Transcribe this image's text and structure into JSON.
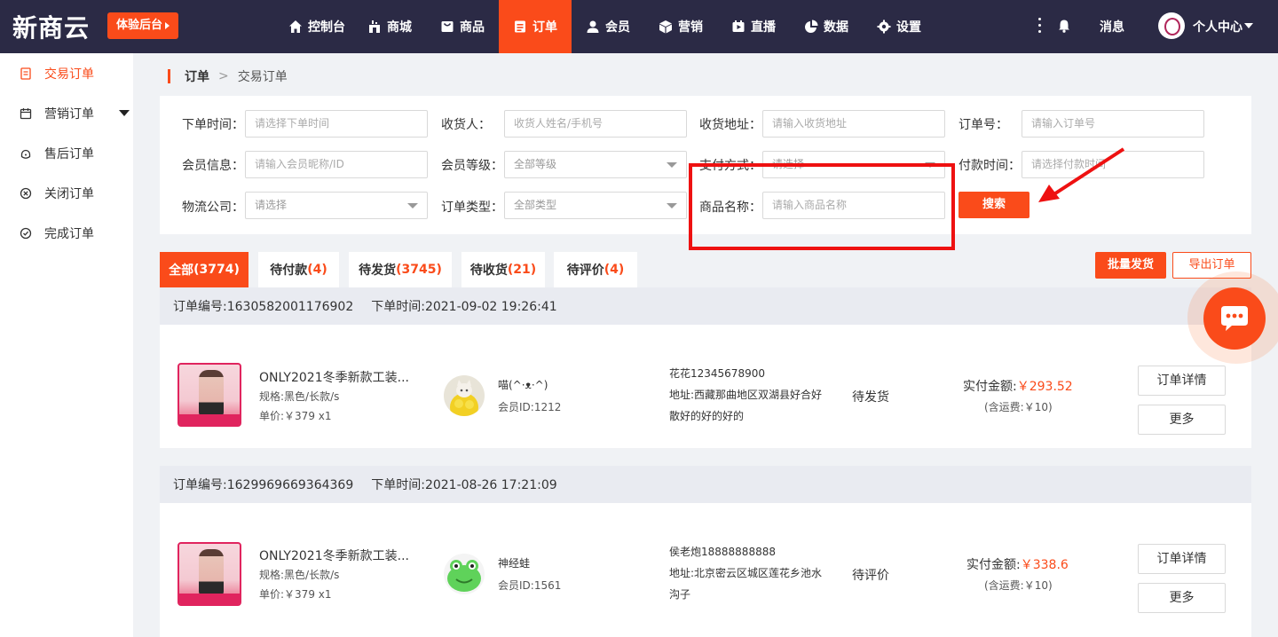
{
  "topbar": {
    "logo": "新商云",
    "trial_button": "体验后台",
    "nav": [
      {
        "label": "控制台",
        "icon": "home-icon",
        "active": false
      },
      {
        "label": "商城",
        "icon": "store-icon",
        "active": false
      },
      {
        "label": "商品",
        "icon": "goods-icon",
        "active": false
      },
      {
        "label": "订单",
        "icon": "order-icon",
        "active": true
      },
      {
        "label": "会员",
        "icon": "user-icon",
        "active": false
      },
      {
        "label": "营销",
        "icon": "cube-icon",
        "active": false
      },
      {
        "label": "直播",
        "icon": "live-icon",
        "active": false
      },
      {
        "label": "数据",
        "icon": "pie-chart-icon",
        "active": false
      },
      {
        "label": "设置",
        "icon": "gear-icon",
        "active": false
      }
    ],
    "messages_label": "消息",
    "profile_label": "个人中心"
  },
  "sidebar": {
    "items": [
      {
        "label": "交易订单",
        "icon": "document-icon",
        "active": true
      },
      {
        "label": "营销订单",
        "icon": "calendar-icon",
        "active": false,
        "expandable": true
      },
      {
        "label": "售后订单",
        "icon": "headset-icon",
        "active": false
      },
      {
        "label": "关闭订单",
        "icon": "close-circle-icon",
        "active": false
      },
      {
        "label": "完成订单",
        "icon": "check-circle-icon",
        "active": false
      }
    ]
  },
  "breadcrumb": {
    "root": "订单",
    "separator": ">",
    "current": "交易订单"
  },
  "filters": {
    "order_time": {
      "label": "下单时间：",
      "placeholder": "请选择下单时间"
    },
    "receiver": {
      "label": "收货人：",
      "placeholder": "收货人姓名/手机号"
    },
    "address": {
      "label": "收货地址：",
      "placeholder": "请输入收货地址"
    },
    "order_no": {
      "label": "订单号：",
      "placeholder": "请输入订单号"
    },
    "member_info": {
      "label": "会员信息：",
      "placeholder": "请输入会员昵称/ID"
    },
    "member_level": {
      "label": "会员等级：",
      "value": "全部等级"
    },
    "pay_method": {
      "label": "支付方式：",
      "value": "请选择"
    },
    "pay_time": {
      "label": "付款时间：",
      "placeholder": "请选择付款时间"
    },
    "logistics": {
      "label": "物流公司：",
      "value": "请选择"
    },
    "order_type": {
      "label": "订单类型：",
      "value": "全部类型"
    },
    "product_name": {
      "label": "商品名称：",
      "placeholder": "请输入商品名称"
    },
    "search_button": "搜索"
  },
  "tabs": [
    {
      "label": "全部",
      "count": "(3774)",
      "active": true
    },
    {
      "label": "待付款",
      "count": "(4)",
      "active": false
    },
    {
      "label": "待发货",
      "count": "(3745)",
      "active": false
    },
    {
      "label": "待收货",
      "count": "(21)",
      "active": false
    },
    {
      "label": "待评价",
      "count": "(4)",
      "active": false
    }
  ],
  "actions": {
    "bulk_ship": "批量发货",
    "export": "导出订单"
  },
  "orders": [
    {
      "order_no": "订单编号:1630582001176902",
      "order_time": "下单时间:2021-09-02 19:26:41",
      "product_title": "ONLY2021冬季新款工装...",
      "product_spec": "规格:黑色/长款/s",
      "product_price": "单价:￥379   x1",
      "member_name": "喵(^·ᴥ·^)",
      "member_id": "会员ID:1212",
      "receiver": "花花12345678900",
      "address": "地址:西藏那曲地区双湖县好合好散好的好的好的",
      "status": "待发货",
      "paid_label": "实付金额:",
      "paid_amount": "￥293.52",
      "shipping": "(含运费:￥10)",
      "detail_button": "订单详情",
      "more_button": "更多"
    },
    {
      "order_no": "订单编号:1629969669364369",
      "order_time": "下单时间:2021-08-26 17:21:09",
      "product_title": "ONLY2021冬季新款工装...",
      "product_spec": "规格:黑色/长款/s",
      "product_price": "单价:￥379   x1",
      "member_name": "神经蛙",
      "member_id": "会员ID:1561",
      "receiver": "侯老炮18888888888",
      "address": "地址:北京密云区城区莲花乡池水沟子",
      "status": "待评价",
      "paid_label": "实付金额:",
      "paid_amount": "￥338.6",
      "shipping": "(含运费:￥10)",
      "detail_button": "订单详情",
      "more_button": "更多"
    }
  ],
  "colors": {
    "accent": "#fa4b1a",
    "topbar": "#2b2a45",
    "annotation": "#ee1111"
  }
}
